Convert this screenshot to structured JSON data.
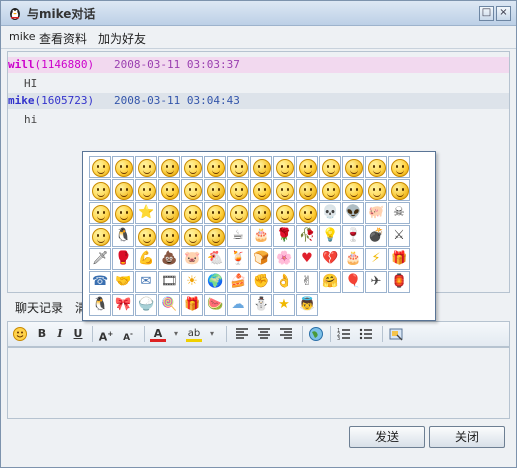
{
  "window": {
    "title": "与mike对话",
    "controls": {
      "minimize": "□",
      "close": "×"
    }
  },
  "menu": {
    "user": "mike",
    "items": [
      "查看资料",
      "加为好友"
    ]
  },
  "chat": {
    "messages": [
      {
        "name": "will",
        "uid": "(1146880)",
        "time": "2008-03-11 03:03:37",
        "text": "HI",
        "name_color": "#cc00cc",
        "band_color": "#f2d9ef"
      },
      {
        "name": "mike",
        "uid": "(1605723)",
        "time": "2008-03-11 03:04:43",
        "text": "hi",
        "name_color": "#3333cc",
        "band_color": "#dde3ea"
      }
    ]
  },
  "tabs": {
    "history": "聊天记录",
    "clear": "清"
  },
  "buttons": {
    "send": "发送",
    "close": "关闭"
  },
  "emoticons": {
    "count": 90,
    "icons": [
      "smile",
      "grin",
      "love",
      "shy",
      "cool",
      "cry",
      "awkward",
      "angry",
      "wink",
      "laugh",
      "surprised",
      "sad",
      "cool2",
      "tongue",
      "sweat",
      "frown",
      "shocked",
      "sleep",
      "dizzy",
      "puke",
      "giggle",
      "happy",
      "cute",
      "wrong",
      "hungry",
      "tired",
      "scared",
      "toothy",
      "grin2",
      "devil",
      "star-face",
      "smirk",
      "sleepy",
      "upset",
      "proud",
      "red-eyes",
      "greedy",
      "shout",
      "skull",
      "alien",
      "pig",
      "pirate",
      "clap",
      "penguin",
      "nose",
      "shh",
      "sly",
      "pig2",
      "coffee",
      "cake",
      "rose",
      "wilted-rose",
      "lightbulb",
      "wine",
      "bomb",
      "cross-swords",
      "sword",
      "boxing",
      "arm",
      "poop",
      "pig-face",
      "chicken",
      "drink",
      "bread",
      "flower",
      "heart",
      "broken-heart",
      "cake2",
      "lightning",
      "gift",
      "phone",
      "handshake",
      "mail",
      "film",
      "sun",
      "earth",
      "cake3",
      "fist",
      "hand-ok",
      "v-sign",
      "hug",
      "balloon",
      "jet",
      "lamp",
      "penguin2",
      "ribbon",
      "rice",
      "lollipop",
      "gift2",
      "watermelon",
      "cloud",
      "ghost",
      "star",
      "angel"
    ]
  }
}
